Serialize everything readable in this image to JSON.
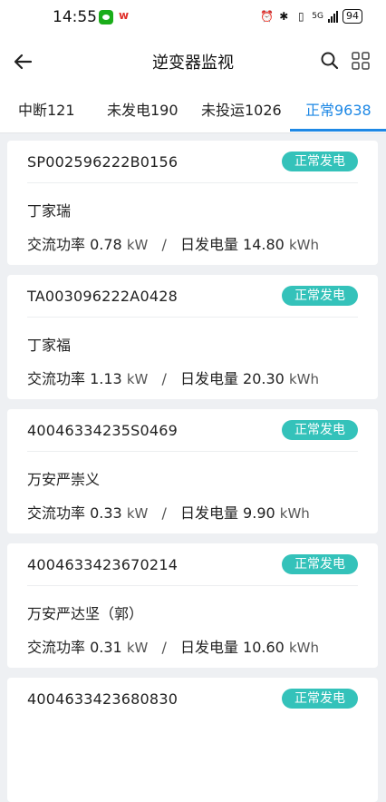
{
  "status_bar": {
    "time": "14:55",
    "battery": "94",
    "network": "5G"
  },
  "header": {
    "title": "逆变器监视"
  },
  "tabs": [
    {
      "label": "中断121",
      "active": false
    },
    {
      "label": "未发电190",
      "active": false
    },
    {
      "label": "未投运1026",
      "active": false
    },
    {
      "label": "正常9638",
      "active": true
    }
  ],
  "labels": {
    "ac_power": "交流功率",
    "daily_energy": "日发电量",
    "separator": "/",
    "kw": "kW",
    "kwh": "kWh"
  },
  "inverters": [
    {
      "code": "SP002596222B0156",
      "status": "正常发电",
      "owner": "丁家瑞",
      "ac_power": "0.78",
      "daily_energy": "14.80"
    },
    {
      "code": "TA003096222A0428",
      "status": "正常发电",
      "owner": "丁家福",
      "ac_power": "1.13",
      "daily_energy": "20.30"
    },
    {
      "code": "40046334235S0469",
      "status": "正常发电",
      "owner": "万安严崇义",
      "ac_power": "0.33",
      "daily_energy": "9.90"
    },
    {
      "code": "4004633423670214",
      "status": "正常发电",
      "owner": "万安严达坚（郭）",
      "ac_power": "0.31",
      "daily_energy": "10.60"
    },
    {
      "code": "4004633423680830",
      "status": "正常发电",
      "owner": "",
      "ac_power": "",
      "daily_energy": ""
    }
  ],
  "colors": {
    "accent": "#1e88e5",
    "status_badge": "#34c2ba",
    "background": "#eef0f3"
  }
}
